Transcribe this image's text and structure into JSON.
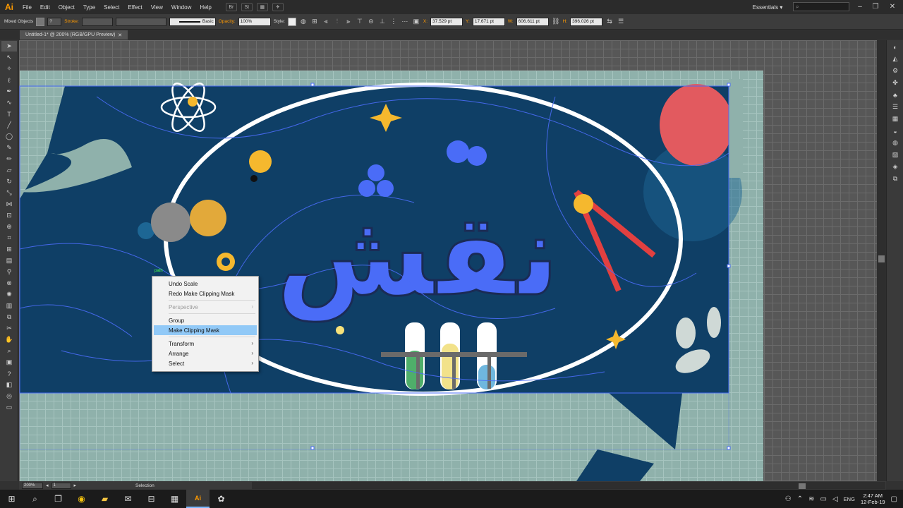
{
  "app": {
    "logo": "Ai"
  },
  "menu": [
    "File",
    "Edit",
    "Object",
    "Type",
    "Select",
    "Effect",
    "View",
    "Window",
    "Help"
  ],
  "menu_icons": [
    "Br",
    "St",
    "arrange-documents-icon",
    "gpu-performance-icon"
  ],
  "workspace": "Essentials",
  "control": {
    "selection": "Mixed Objects",
    "stroke_label": "Stroke:",
    "brush": "Basic",
    "opacity_label": "Opacity:",
    "opacity_value": "100%",
    "style_label": "Style:",
    "x_label": "X:",
    "x_value": "37.529 pt",
    "y_label": "Y:",
    "y_value": "17.671 pt",
    "w_label": "W:",
    "w_value": "606.611 pt",
    "h_label": "H:",
    "h_value": "396.026 pt"
  },
  "document_tab": "Untitled-1* @ 200% (RGB/GPU Preview)",
  "status": {
    "zoom": "200%",
    "artboard": "1",
    "tool": "Selection"
  },
  "canvas_hint": "path",
  "context_menu": [
    {
      "label": "Undo Scale",
      "disabled": false,
      "submenu": false
    },
    {
      "label": "Redo Make Clipping Mask",
      "disabled": false,
      "submenu": false
    },
    {
      "sep": true
    },
    {
      "label": "Perspective",
      "disabled": true,
      "submenu": true
    },
    {
      "sep": true
    },
    {
      "label": "Group",
      "disabled": false,
      "submenu": false
    },
    {
      "label": "Make Clipping Mask",
      "disabled": false,
      "submenu": false,
      "highlight": true
    },
    {
      "sep": true
    },
    {
      "label": "Transform",
      "disabled": false,
      "submenu": true
    },
    {
      "label": "Arrange",
      "disabled": false,
      "submenu": true
    },
    {
      "label": "Select",
      "disabled": false,
      "submenu": true
    }
  ],
  "artwork_title": "نقش",
  "colors": {
    "navy": "#0f3f66",
    "navy_light": "#1d6694",
    "selection": "#4a6cf7",
    "accent_yellow": "#f5b82e",
    "red": "#e25a5f",
    "teal_bg": "#8fb1ab"
  },
  "taskbar": {
    "language": "ENG",
    "time": "2:47 AM",
    "date": "12-Feb-19"
  }
}
